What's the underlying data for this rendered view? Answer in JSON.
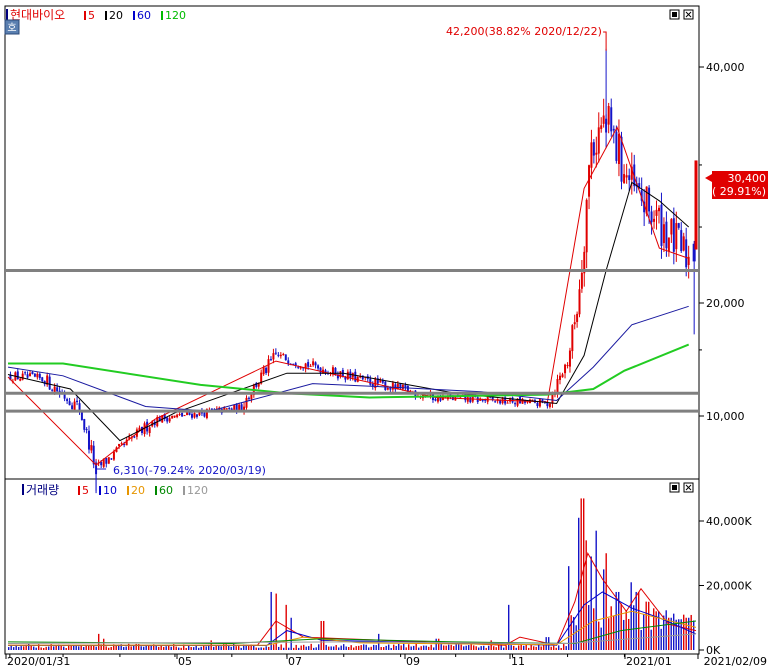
{
  "stock_name": "현대바이오",
  "hoga_badge": "호",
  "price_legend": [
    {
      "label": "5",
      "color": "#e00000"
    },
    {
      "label": "20",
      "color": "#000000"
    },
    {
      "label": "60",
      "color": "#0000cc"
    },
    {
      "label": "120",
      "color": "#00bb00"
    }
  ],
  "volume_title": "거래량",
  "volume_legend": [
    {
      "label": "5",
      "color": "#e00000"
    },
    {
      "label": "10",
      "color": "#0000cc"
    },
    {
      "label": "20",
      "color": "#e69500"
    },
    {
      "label": "60",
      "color": "#008800"
    },
    {
      "label": "120",
      "color": "#999999"
    }
  ],
  "colors": {
    "up": "#e00000",
    "down": "#1414c8",
    "ma5": "#e00000",
    "ma20": "#000000",
    "ma60": "#1a1aa0",
    "ma120": "#22cc22"
  },
  "annotations": {
    "high": "42,200(38.82% 2020/12/22)",
    "low": "6,310(-79.24% 2020/03/19)"
  },
  "current_price": {
    "price": "30,400",
    "change": "( 29.91%)"
  },
  "chart_data": [
    {
      "type": "candlestick",
      "title": "현대바이오",
      "y_ticks": [
        "40,000",
        "20,000",
        "10,000"
      ],
      "x_ticks": [
        "2020/01/31",
        "05",
        "07",
        "09",
        "11",
        "2021/01",
        "2021/02/09"
      ],
      "horizontal_lines": [
        22000,
        11500,
        10300
      ],
      "high": {
        "value": 42200,
        "date": "2020/12/22",
        "pct": 38.82
      },
      "low": {
        "value": 6310,
        "date": "2020/03/19",
        "pct": -79.24
      },
      "last_price": 30400,
      "last_change_pct": 29.91,
      "segments": [
        {
          "from": "2020/01/31",
          "to": "2020/02/20",
          "start": 12800,
          "end": 12500,
          "vol": 0.25
        },
        {
          "from": "2020/02/20",
          "to": "2020/03/10",
          "start": 12500,
          "end": 10500,
          "vol": 0.35
        },
        {
          "from": "2020/03/10",
          "to": "2020/03/19",
          "start": 10500,
          "end": 7200,
          "vol": 0.45
        },
        {
          "from": "2020/03/19",
          "to": "2020/04/20",
          "start": 7200,
          "end": 9800,
          "vol": 0.3
        },
        {
          "from": "2020/04/20",
          "to": "2020/06/05",
          "start": 9800,
          "end": 10500,
          "vol": 0.2
        },
        {
          "from": "2020/06/05",
          "to": "2020/06/25",
          "start": 10500,
          "end": 14500,
          "vol": 0.35
        },
        {
          "from": "2020/06/25",
          "to": "2020/08/10",
          "start": 14500,
          "end": 12500,
          "vol": 0.25
        },
        {
          "from": "2020/08/10",
          "to": "2020/09/20",
          "start": 12500,
          "end": 11200,
          "vol": 0.25
        },
        {
          "from": "2020/09/20",
          "to": "2020/11/20",
          "start": 11200,
          "end": 10800,
          "vol": 0.2
        },
        {
          "from": "2020/11/20",
          "to": "2020/12/01",
          "start": 10800,
          "end": 14000,
          "vol": 0.4
        },
        {
          "from": "2020/12/01",
          "to": "2020/12/14",
          "start": 14000,
          "end": 32000,
          "vol": 0.6
        },
        {
          "from": "2020/12/14",
          "to": "2020/12/22",
          "start": 32000,
          "end": 34000,
          "vol": 0.7
        },
        {
          "from": "2020/12/22",
          "to": "2021/01/05",
          "start": 34000,
          "end": 28000,
          "vol": 0.6
        },
        {
          "from": "2021/01/05",
          "to": "2021/02/05",
          "start": 28000,
          "end": 22800,
          "vol": 0.5
        }
      ],
      "moving_averages": {
        "ma5": [
          [
            "2020/01/31",
            12700
          ],
          [
            "2020/03/19",
            7400
          ],
          [
            "2020/04/20",
            9800
          ],
          [
            "2020/06/25",
            14000
          ],
          [
            "2020/09/20",
            11200
          ],
          [
            "2020/11/20",
            10900
          ],
          [
            "2020/12/10",
            28000
          ],
          [
            "2020/12/28",
            33500
          ],
          [
            "2021/01/20",
            23500
          ],
          [
            "2021/02/05",
            22800
          ]
        ],
        "ma20": [
          [
            "2020/01/31",
            12900
          ],
          [
            "2020/03/05",
            11800
          ],
          [
            "2020/04/01",
            8600
          ],
          [
            "2020/05/01",
            10200
          ],
          [
            "2020/07/01",
            13000
          ],
          [
            "2020/08/01",
            13000
          ],
          [
            "2020/10/01",
            11500
          ],
          [
            "2020/11/25",
            10800
          ],
          [
            "2020/12/10",
            14500
          ],
          [
            "2020/12/22",
            22000
          ],
          [
            "2021/01/05",
            28500
          ],
          [
            "2021/01/20",
            27000
          ],
          [
            "2021/02/05",
            25000
          ]
        ],
        "ma60": [
          [
            "2020/01/31",
            13500
          ],
          [
            "2020/03/01",
            12800
          ],
          [
            "2020/04/15",
            10600
          ],
          [
            "2020/05/20",
            10300
          ],
          [
            "2020/07/15",
            12200
          ],
          [
            "2020/09/01",
            11900
          ],
          [
            "2020/10/15",
            11600
          ],
          [
            "2020/11/25",
            11000
          ],
          [
            "2020/12/15",
            13500
          ],
          [
            "2021/01/05",
            17500
          ],
          [
            "2021/02/05",
            19600
          ]
        ],
        "ma120": [
          [
            "2020/01/31",
            13800
          ],
          [
            "2020/03/01",
            13800
          ],
          [
            "2020/05/15",
            12100
          ],
          [
            "2020/07/01",
            11500
          ],
          [
            "2020/08/15",
            11200
          ],
          [
            "2020/10/01",
            11300
          ],
          [
            "2020/11/20",
            11400
          ],
          [
            "2020/12/15",
            11800
          ],
          [
            "2021/01/01",
            13200
          ],
          [
            "2021/02/05",
            15500
          ]
        ]
      },
      "last_bar": {
        "date": "2021/02/09",
        "open": 23400,
        "close": 30400,
        "high": 30400,
        "low": 23400
      },
      "prev_bar": {
        "date": "2021/02/08",
        "open": 23800,
        "close": 22600,
        "high": 24000,
        "low": 16500
      }
    },
    {
      "type": "bar",
      "title": "거래량",
      "y_ticks": [
        "40,000K",
        "20,000K",
        "0K"
      ],
      "units": "K",
      "base_level": 1500,
      "spikes": [
        {
          "date": "2020/03/20",
          "value": 5000
        },
        {
          "date": "2020/03/23",
          "value": 3500
        },
        {
          "date": "2020/05/20",
          "value": 3000
        },
        {
          "date": "2020/06/22",
          "value": 18000
        },
        {
          "date": "2020/06/25",
          "value": 17500
        },
        {
          "date": "2020/06/30",
          "value": 14000
        },
        {
          "date": "2020/07/03",
          "value": 10000
        },
        {
          "date": "2020/07/20",
          "value": 9000
        },
        {
          "date": "2020/08/20",
          "value": 5000
        },
        {
          "date": "2020/09/21",
          "value": 3500
        },
        {
          "date": "2020/10/20",
          "value": 3000
        },
        {
          "date": "2020/10/30",
          "value": 14000
        },
        {
          "date": "2020/11/20",
          "value": 4000
        },
        {
          "date": "2020/12/02",
          "value": 26000
        },
        {
          "date": "2020/12/07",
          "value": 41000
        },
        {
          "date": "2020/12/09",
          "value": 47000
        },
        {
          "date": "2020/12/11",
          "value": 34000
        },
        {
          "date": "2020/12/14",
          "value": 29000
        },
        {
          "date": "2020/12/16",
          "value": 37000
        },
        {
          "date": "2020/12/21",
          "value": 25000
        },
        {
          "date": "2020/12/22",
          "value": 30000
        },
        {
          "date": "2020/12/28",
          "value": 18000
        },
        {
          "date": "2021/01/04",
          "value": 21000
        },
        {
          "date": "2021/01/08",
          "value": 18000
        },
        {
          "date": "2021/01/12",
          "value": 15000
        },
        {
          "date": "2021/01/19",
          "value": 12000
        },
        {
          "date": "2021/01/26",
          "value": 10000
        },
        {
          "date": "2021/02/04",
          "value": 10000
        },
        {
          "date": "2021/02/09",
          "value": 18500
        }
      ]
    }
  ]
}
